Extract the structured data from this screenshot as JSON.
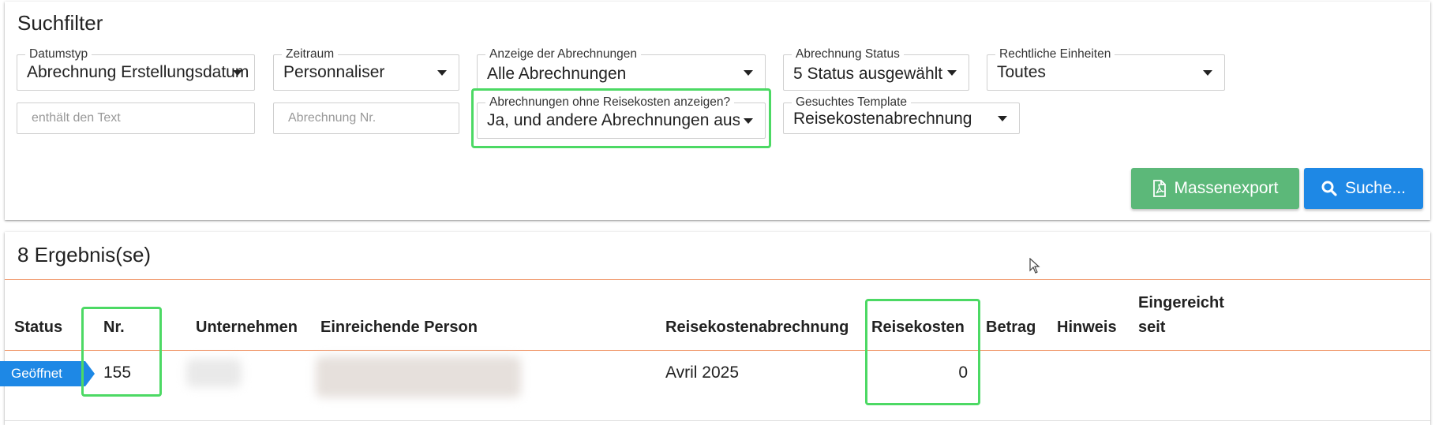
{
  "filter": {
    "title": "Suchfilter",
    "datumstyp": {
      "label": "Datumstyp",
      "value": "Abrechnung Erstellungsdatum"
    },
    "zeitraum": {
      "label": "Zeitraum",
      "value": "Personnaliser"
    },
    "anzeige": {
      "label": "Anzeige der Abrechnungen",
      "value": "Alle Abrechnungen"
    },
    "status": {
      "label": "Abrechnung Status",
      "value": "5 Status ausgewählt"
    },
    "einheiten": {
      "label": "Rechtliche Einheiten",
      "value": "Toutes"
    },
    "text_search": {
      "placeholder": "enthält den Text"
    },
    "nr_search": {
      "placeholder": "Abrechnung Nr."
    },
    "ohne_reisekosten": {
      "label": "Abrechnungen ohne Reisekosten anzeigen?",
      "value": "Ja, und andere Abrechnungen ausblen"
    },
    "template": {
      "label": "Gesuchtes Template",
      "value": "Reisekostenabrechnung"
    },
    "export_label": "Massenexport",
    "search_label": "Suche..."
  },
  "results": {
    "title": "8 Ergebnis(se)",
    "columns": {
      "status": "Status",
      "nr": "Nr.",
      "unternehmen": "Unternehmen",
      "person": "Einreichende Person",
      "abrechnung": "Reisekostenabrechnung",
      "reisekosten": "Reisekosten",
      "betrag": "Betrag",
      "hinweis": "Hinweis",
      "eingereicht_1": "Eingereicht",
      "eingereicht_2": "seit"
    },
    "rows": [
      {
        "status": "Geöffnet",
        "nr": "155",
        "abrechnung": "Avril 2025",
        "reisekosten": "0"
      }
    ]
  },
  "colors": {
    "accent_blue": "#1e88e5",
    "export_green": "#5cb879",
    "highlight_green": "#4cd964",
    "divider_orange": "#f2a27a"
  }
}
